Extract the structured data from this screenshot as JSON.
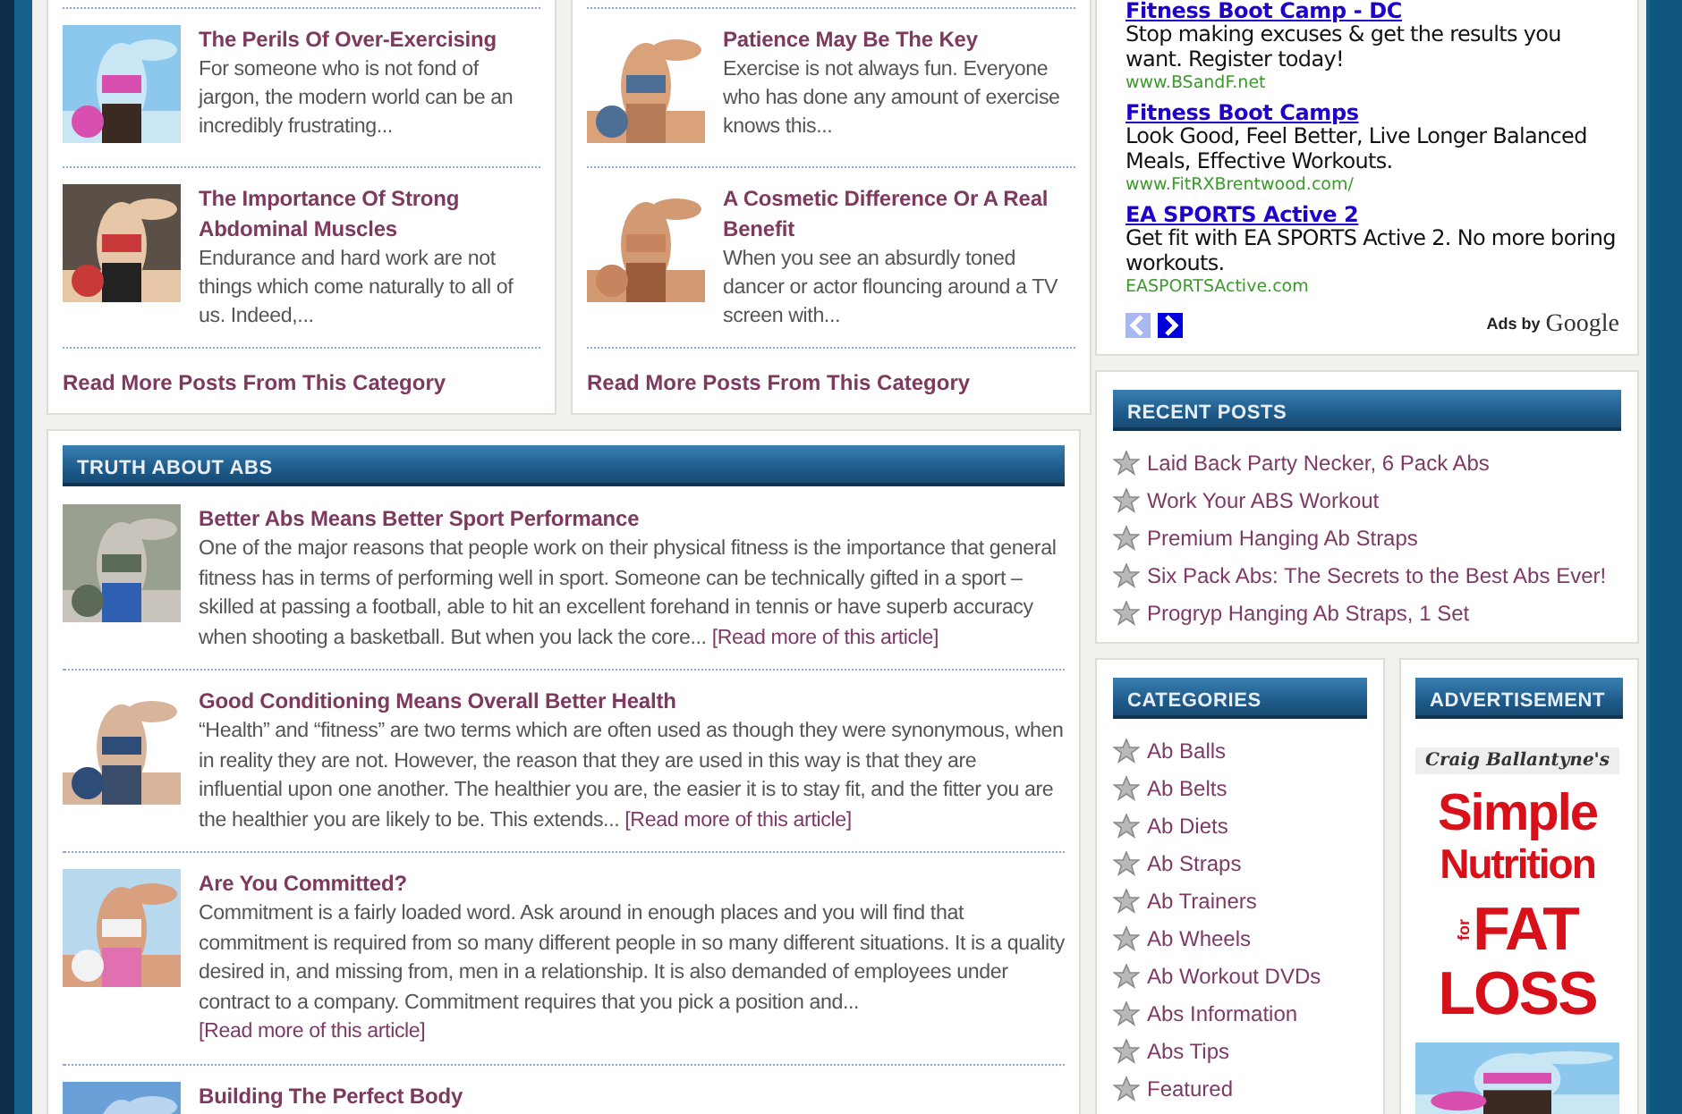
{
  "category_boxes": [
    {
      "posts": [
        {
          "title": "The Perils Of Over-Exercising",
          "excerpt": "For someone who is not fond of jargon, the modern world can be an incredibly frustrating..."
        },
        {
          "title": "The Importance Of Strong Abdominal Muscles",
          "excerpt": "Endurance and hard work are not things which come naturally to all of us. Indeed,..."
        }
      ],
      "more_link": "Read More Posts From This Category"
    },
    {
      "posts": [
        {
          "title": "Patience May Be The Key",
          "excerpt": "Exercise is not always fun. Everyone who has done any amount of exercise knows this..."
        },
        {
          "title": "A Cosmetic Difference Or A Real Benefit",
          "excerpt": "When you see an absurdly toned dancer or actor flouncing around a TV screen with..."
        }
      ],
      "more_link": "Read More Posts From This Category"
    }
  ],
  "truth_about_abs": {
    "title": "TRUTH ABOUT ABS",
    "articles": [
      {
        "title": "Better Abs Means Better Sport Performance",
        "excerpt": "One of the major reasons that people work on their physical fitness is the importance that general fitness has in terms of performing well in sport. Someone can be technically gifted in a sport – skilled at passing a football, able to hit an excellent forehand in tennis or have superb accuracy when shooting a basketball. But when you lack the core...",
        "link": "[Read more of this article]"
      },
      {
        "title": "Good Conditioning Means Overall Better Health",
        "excerpt": "“Health” and “fitness” are two terms which are often used as though they were synonymous, when in reality they are not. However, the reason that they are used in this way is that they are influential upon one another. The healthier you are, the easier it is to stay fit, and the fitter you are the healthier you are likely to be. This extends...",
        "link": "[Read more of this article]"
      },
      {
        "title": "Are You Committed?",
        "excerpt": "Commitment is a fairly loaded word. Ask around in enough places and you will find that commitment is required from so many different people in so many different situations. It is a quality desired in, and missing from, men in a relationship. It is also demanded of employees under contract to a company. Commitment requires that you pick a position and...",
        "link": "[Read more of this article]"
      },
      {
        "title": "Building The Perfect Body"
      }
    ]
  },
  "ads": {
    "items": [
      {
        "title": "Fitness Boot Camp - DC",
        "text": "Stop making excuses & get the results you want. Register today!",
        "url": "www.BSandF.net"
      },
      {
        "title": "Fitness Boot Camps",
        "text": "Look Good, Feel Better, Live Longer Balanced Meals, Effective Workouts.",
        "url": "www.FitRXBrentwood.com/"
      },
      {
        "title": "EA SPORTS Active 2",
        "text": "Get fit with EA SPORTS Active 2. No more boring workouts.",
        "url": "EASPORTSActive.com"
      }
    ],
    "pager": [
      {
        "kind": "prev",
        "disabled": true
      },
      {
        "kind": "next",
        "disabled": false
      }
    ],
    "attribution": "Ads by",
    "brand": "Google"
  },
  "recent_posts": {
    "title": "RECENT POSTS",
    "items": [
      "Laid Back Party Necker, 6 Pack Abs",
      "Work Your ABS Workout",
      "Premium Hanging Ab Straps",
      "Six Pack Abs: The Secrets to the Best Abs Ever!",
      "Progryp Hanging Ab Straps, 1 Set"
    ]
  },
  "categories": {
    "title": "CATEGORIES",
    "items": [
      "Ab Balls",
      "Ab Belts",
      "Ab Diets",
      "Ab Straps",
      "Ab Trainers",
      "Ab Wheels",
      "Ab Workout DVDs",
      "Abs Information",
      "Abs Tips",
      "Featured"
    ]
  },
  "advertisement": {
    "title": "ADVERTISEMENT",
    "banner": {
      "author": "Craig Ballantyne's",
      "line_1": "Simple",
      "line_2": "Nutrition",
      "small": "for",
      "big_1": "FAT",
      "big_2": "LOSS"
    }
  }
}
